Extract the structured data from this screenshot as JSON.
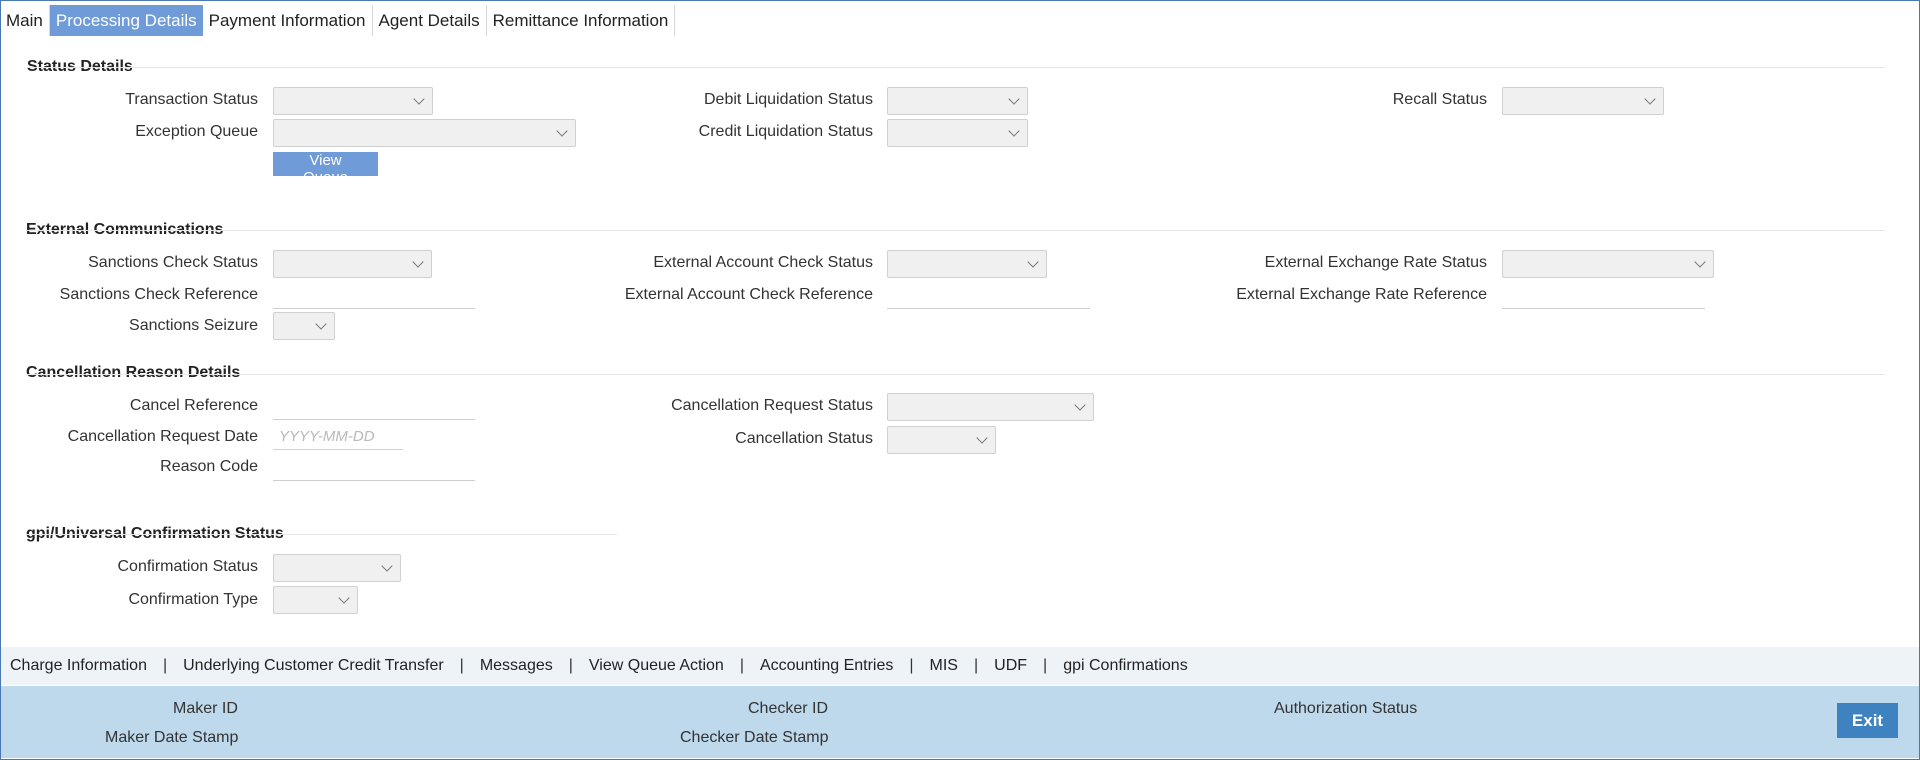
{
  "tabs": [
    {
      "label": "Main"
    },
    {
      "label": "Processing Details"
    },
    {
      "label": "Payment Information"
    },
    {
      "label": "Agent Details"
    },
    {
      "label": "Remittance Information"
    }
  ],
  "status_details": {
    "title": "Status Details",
    "transaction_status": "Transaction Status",
    "exception_queue": "Exception Queue",
    "view_queue": "View Queue",
    "debit_liquidation_status": "Debit Liquidation Status",
    "credit_liquidation_status": "Credit Liquidation Status",
    "recall_status": "Recall Status"
  },
  "external_communications": {
    "title": "External Communications",
    "sanctions_check_status": "Sanctions Check Status",
    "sanctions_check_reference": "Sanctions Check Reference",
    "sanctions_seizure": "Sanctions Seizure",
    "external_account_check_status": "External Account Check Status",
    "external_account_check_reference": "External Account Check Reference",
    "external_exchange_rate_status": "External Exchange Rate Status",
    "external_exchange_rate_reference": "External Exchange Rate Reference"
  },
  "cancellation": {
    "title": "Cancellation Reason Details",
    "cancel_reference": "Cancel Reference",
    "cancellation_request_date": "Cancellation Request Date",
    "date_placeholder": "YYYY-MM-DD",
    "reason_code": "Reason Code",
    "cancellation_request_status": "Cancellation Request Status",
    "cancellation_status": "Cancellation Status"
  },
  "gpi": {
    "title": "gpi/Universal Confirmation Status",
    "confirmation_status": "Confirmation Status",
    "confirmation_type": "Confirmation Type"
  },
  "bottom_links": [
    {
      "label": "Charge Information"
    },
    {
      "label": "Underlying Customer Credit Transfer"
    },
    {
      "label": "Messages"
    },
    {
      "label": "View Queue Action"
    },
    {
      "label": "Accounting Entries"
    },
    {
      "label": "MIS"
    },
    {
      "label": "UDF"
    },
    {
      "label": "gpi Confirmations"
    }
  ],
  "footer": {
    "maker_id": "Maker ID",
    "maker_date_stamp": "Maker Date Stamp",
    "checker_id": "Checker ID",
    "checker_date_stamp": "Checker Date Stamp",
    "authorization_status": "Authorization Status",
    "exit": "Exit"
  }
}
